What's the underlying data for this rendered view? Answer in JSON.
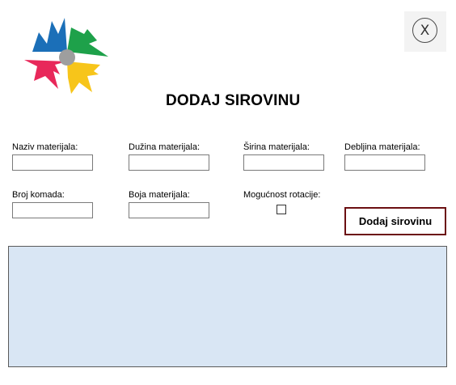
{
  "window": {
    "title": "DODAJ SIROVINU",
    "close_label": "X"
  },
  "logo": {
    "icon": "colorful-pinwheel-logo",
    "colors": {
      "blue": "#1b6fb8",
      "green": "#1ea14a",
      "red": "#e8285a",
      "yellow": "#f7c51a",
      "center": "#9e9e9e"
    }
  },
  "form": {
    "naziv_label": "Naziv materijala:",
    "naziv_value": "",
    "duzina_label": "Dužina materijala:",
    "duzina_value": "",
    "sirina_label": "Širina materijala:",
    "sirina_value": "",
    "debljina_label": "Debljina materijala:",
    "debljina_value": "",
    "broj_label": "Broj komada:",
    "broj_value": "",
    "boja_label": "Boja materijala:",
    "boja_value": "",
    "rotacija_label": "Mogućnost rotacije:",
    "rotacija_checked": false
  },
  "actions": {
    "add_label": "Dodaj sirovinu"
  },
  "colors": {
    "accent_border": "#6b0f12",
    "panel_background": "#d9e6f4"
  }
}
